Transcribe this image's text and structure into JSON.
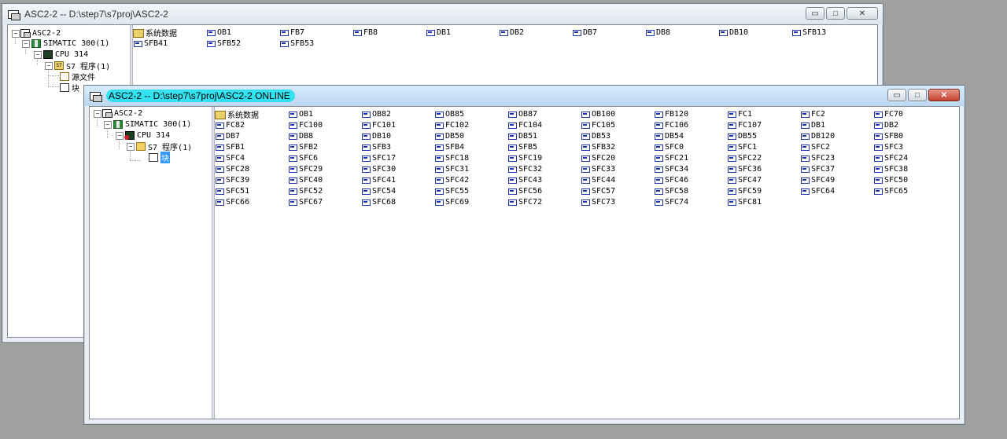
{
  "window1": {
    "title": "ASC2-2 -- D:\\step7\\s7proj\\ASC2-2",
    "tree": {
      "project": "ASC2-2",
      "station": "SIMATIC 300(1)",
      "cpu": "CPU 314",
      "program": "S7 程序(1)",
      "sources": "源文件",
      "blocks": "块"
    },
    "items": [
      {
        "label": "系统数据",
        "icon": "folder-icon"
      },
      {
        "label": "OB1",
        "icon": "block-icon"
      },
      {
        "label": "FB7",
        "icon": "block-icon"
      },
      {
        "label": "FB8",
        "icon": "block-icon"
      },
      {
        "label": "DB1",
        "icon": "block-icon"
      },
      {
        "label": "DB2",
        "icon": "block-icon"
      },
      {
        "label": "DB7",
        "icon": "block-icon"
      },
      {
        "label": "DB8",
        "icon": "block-icon"
      },
      {
        "label": "DB10",
        "icon": "block-icon"
      },
      {
        "label": "SFB13",
        "icon": "block-icon"
      },
      {
        "label": "SFB41",
        "icon": "block-icon"
      },
      {
        "label": "SFB52",
        "icon": "block-icon"
      },
      {
        "label": "SFB53",
        "icon": "block-icon"
      }
    ]
  },
  "window2": {
    "title": "ASC2-2 -- D:\\step7\\s7proj\\ASC2-2  ONLINE",
    "tree": {
      "project": "ASC2-2",
      "station": "SIMATIC 300(1)",
      "cpu": "CPU 314",
      "program": "S7 程序(1)",
      "blocks": "块"
    },
    "items": [
      "系统数据",
      "OB1",
      "OB82",
      "OB85",
      "OB87",
      "OB100",
      "FB120",
      "FC1",
      "FC2",
      "FC70",
      "FC82",
      "FC100",
      "FC101",
      "FC102",
      "FC104",
      "FC105",
      "FC106",
      "FC107",
      "DB1",
      "DB2",
      "DB7",
      "DB8",
      "DB10",
      "DB50",
      "DB51",
      "DB53",
      "DB54",
      "DB55",
      "DB120",
      "SFB0",
      "SFB1",
      "SFB2",
      "SFB3",
      "SFB4",
      "SFB5",
      "SFB32",
      "SFC0",
      "SFC1",
      "SFC2",
      "SFC3",
      "SFC4",
      "SFC6",
      "SFC17",
      "SFC18",
      "SFC19",
      "SFC20",
      "SFC21",
      "SFC22",
      "SFC23",
      "SFC24",
      "SFC28",
      "SFC29",
      "SFC30",
      "SFC31",
      "SFC32",
      "SFC33",
      "SFC34",
      "SFC36",
      "SFC37",
      "SFC38",
      "SFC39",
      "SFC40",
      "SFC41",
      "SFC42",
      "SFC43",
      "SFC44",
      "SFC46",
      "SFC47",
      "SFC49",
      "SFC50",
      "SFC51",
      "SFC52",
      "SFC54",
      "SFC55",
      "SFC56",
      "SFC57",
      "SFC58",
      "SFC59",
      "SFC64",
      "SFC65",
      "SFC66",
      "SFC67",
      "SFC68",
      "SFC69",
      "SFC72",
      "SFC73",
      "SFC74",
      "SFC81"
    ]
  },
  "controls": {
    "minimize": "▭",
    "maximize": "□",
    "close": "✕"
  }
}
